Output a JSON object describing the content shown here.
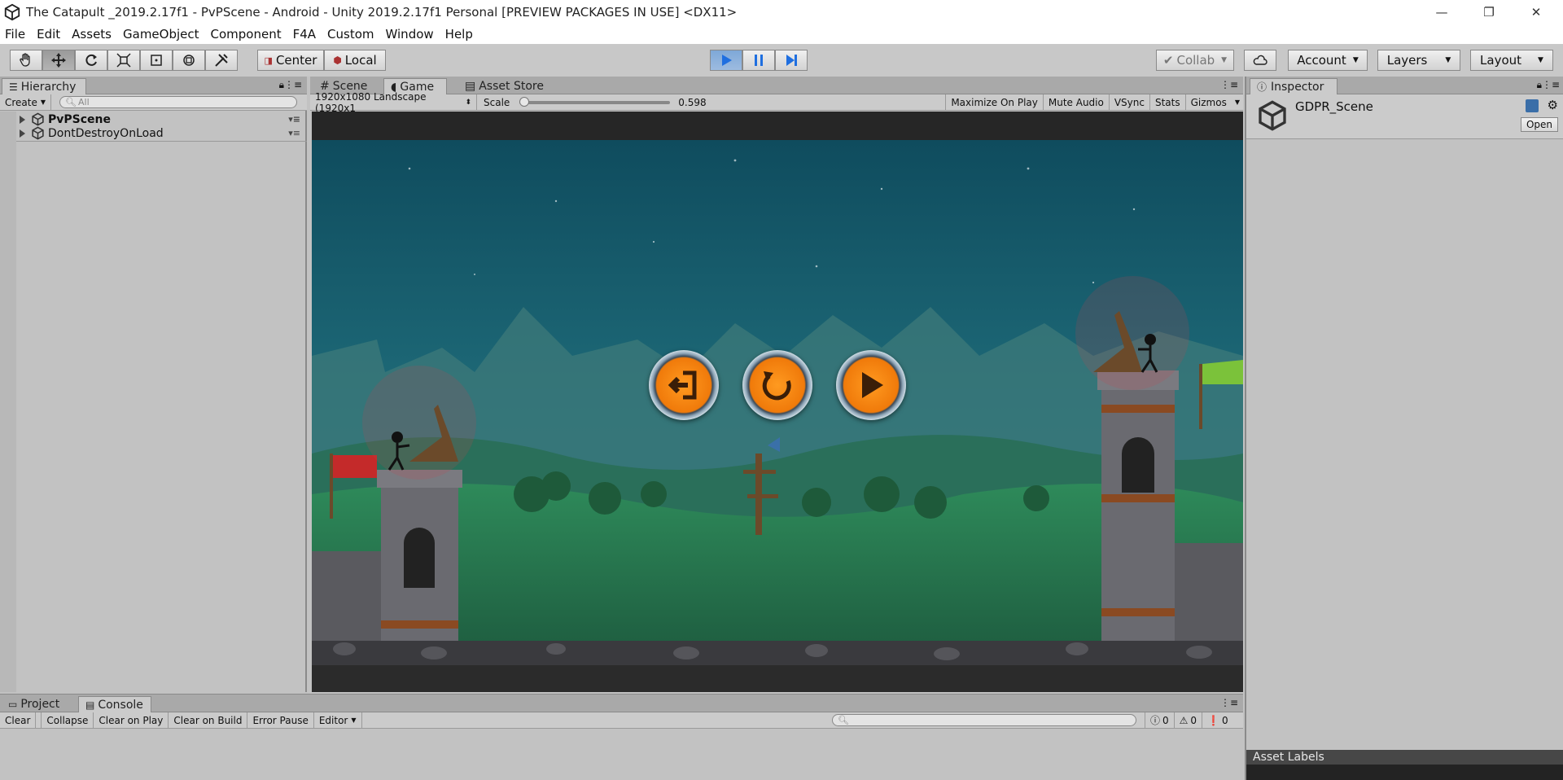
{
  "window": {
    "title": "The Catapult _2019.2.17f1 - PvPScene - Android - Unity 2019.2.17f1 Personal [PREVIEW PACKAGES IN USE] <DX11>",
    "minimize": "—",
    "restore": "❐",
    "close": "✕"
  },
  "menu": [
    "File",
    "Edit",
    "Assets",
    "GameObject",
    "Component",
    "F4A",
    "Custom",
    "Window",
    "Help"
  ],
  "toolbar": {
    "pivot_label": "Center",
    "space_label": "Local",
    "collab_label": "Collab",
    "account_label": "Account",
    "layers_label": "Layers",
    "layout_label": "Layout"
  },
  "hierarchy": {
    "tab": "Hierarchy",
    "create_label": "Create",
    "search_placeholder": "All",
    "items": [
      {
        "label": "PvPScene"
      },
      {
        "label": "DontDestroyOnLoad"
      }
    ]
  },
  "center_tabs": [
    {
      "label": "Scene"
    },
    {
      "label": "Game"
    },
    {
      "label": "Asset Store"
    }
  ],
  "game_bar": {
    "resolution": "1920x1080 Landscape (1920x1",
    "scale_label": "Scale",
    "scale_value": "0.598",
    "scale_fraction": 0.0,
    "maximize": "Maximize On Play",
    "mute": "Mute Audio",
    "vsync": "VSync",
    "stats": "Stats",
    "gizmos": "Gizmos"
  },
  "inspector": {
    "tab": "Inspector",
    "object_name": "GDPR_Scene",
    "open_label": "Open",
    "asset_labels": "Asset Labels"
  },
  "bottom": {
    "tabs": [
      {
        "label": "Project"
      },
      {
        "label": "Console"
      }
    ],
    "clear": "Clear",
    "collapse": "Collapse",
    "clear_on_play": "Clear on Play",
    "clear_on_build": "Clear on Build",
    "error_pause": "Error Pause",
    "editor": "Editor",
    "info_count": "0",
    "warn_count": "0",
    "error_count": "0"
  },
  "colors": {
    "play_accent": "#2b7de9",
    "game_sky": "#1f6b7a",
    "button_orange": "#f07a0a"
  }
}
